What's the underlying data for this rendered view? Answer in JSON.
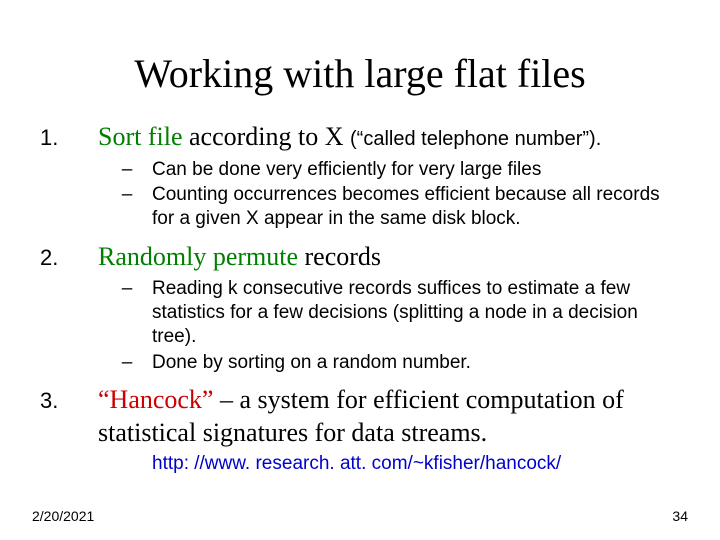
{
  "title": "Working with large flat files",
  "items": [
    {
      "num": "1.",
      "line": {
        "green": "Sort file",
        "rest": " according to X ",
        "sans": "(“called telephone number”)."
      },
      "subs": [
        "Can be done very efficiently for very large files",
        "Counting occurrences becomes efficient because all records for a given X appear in the same disk block."
      ]
    },
    {
      "num": "2.",
      "line": {
        "green": "Randomly permute",
        "rest": " records"
      },
      "subs": [
        "Reading  k  consecutive records suffices to estimate a few statistics for a few decisions (splitting a node in a decision tree).",
        "Done by sorting on a random number."
      ]
    },
    {
      "num": "3.",
      "line": {
        "red": " “Hancock”",
        "rest": " – a system for efficient computation of statistical signatures for data streams."
      },
      "link": "http: //www. research. att. com/~kfisher/hancock/"
    }
  ],
  "footer": {
    "date": "2/20/2021",
    "page": "34"
  }
}
